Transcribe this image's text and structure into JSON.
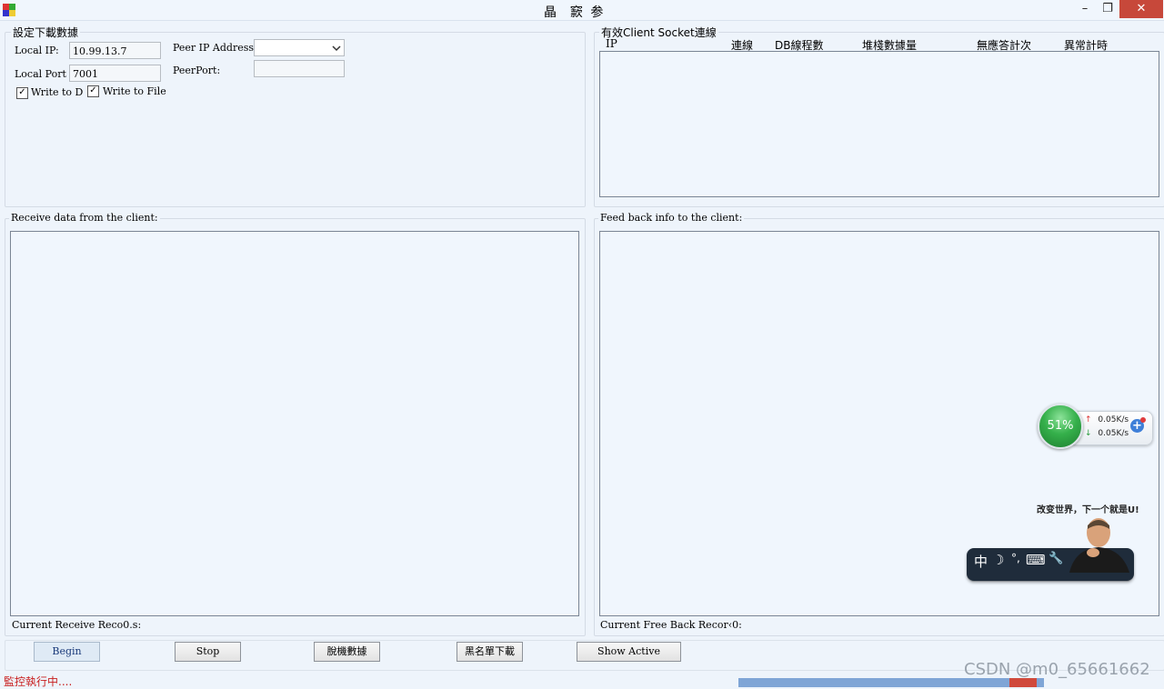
{
  "window": {
    "title": "晶  窾 参",
    "minimize": "–",
    "maximize": "❐",
    "close": "✕"
  },
  "settings": {
    "group_title": "設定下載數據",
    "local_ip_label": "Local IP:",
    "local_ip_value": "10.99.13.7",
    "local_port_label": "Local Port",
    "local_port_value": "7001",
    "peer_ip_label": "Peer IP Address",
    "peer_ip_value": "",
    "peer_port_label": "PeerPort:",
    "peer_port_value": "",
    "write_db_label": "Write to D",
    "write_db_checked": true,
    "write_file_label": "Write to File",
    "write_file_checked": true
  },
  "connections": {
    "group_title": "有效Client Socket連線",
    "columns": [
      "IP",
      "連線",
      "DB線程數",
      "堆棧數據量",
      "無應答計次",
      "異常計時"
    ]
  },
  "receive": {
    "group_title": "Receive data from the client:",
    "footer": "Current Receive Reco0.s:"
  },
  "feedback": {
    "group_title": "Feed back info to the client:",
    "footer": "Current Free Back Recor‹0:"
  },
  "buttons": {
    "begin": "Begin",
    "stop": "Stop",
    "offline": "脫機數據",
    "blacklist": "黑名單下載",
    "show_active": "Show Active"
  },
  "net_monitor": {
    "percent": "51%",
    "upload": "0.05K/s",
    "download": "0.05K/s",
    "up_arrow": "↑",
    "down_arrow": "↓",
    "plus": "+"
  },
  "ime": {
    "caption": "改变世界，下一个就是U!",
    "mode": "中",
    "moon": "☽",
    "punct": "°,",
    "keyboard": "⌨",
    "wrench": "🔧"
  },
  "status_text": "監控執行中....",
  "watermark": "CSDN @m0_65661662",
  "colors": {
    "background": "#eef4fb",
    "status_red": "#c81e1e",
    "net_green": "#35b04b"
  }
}
